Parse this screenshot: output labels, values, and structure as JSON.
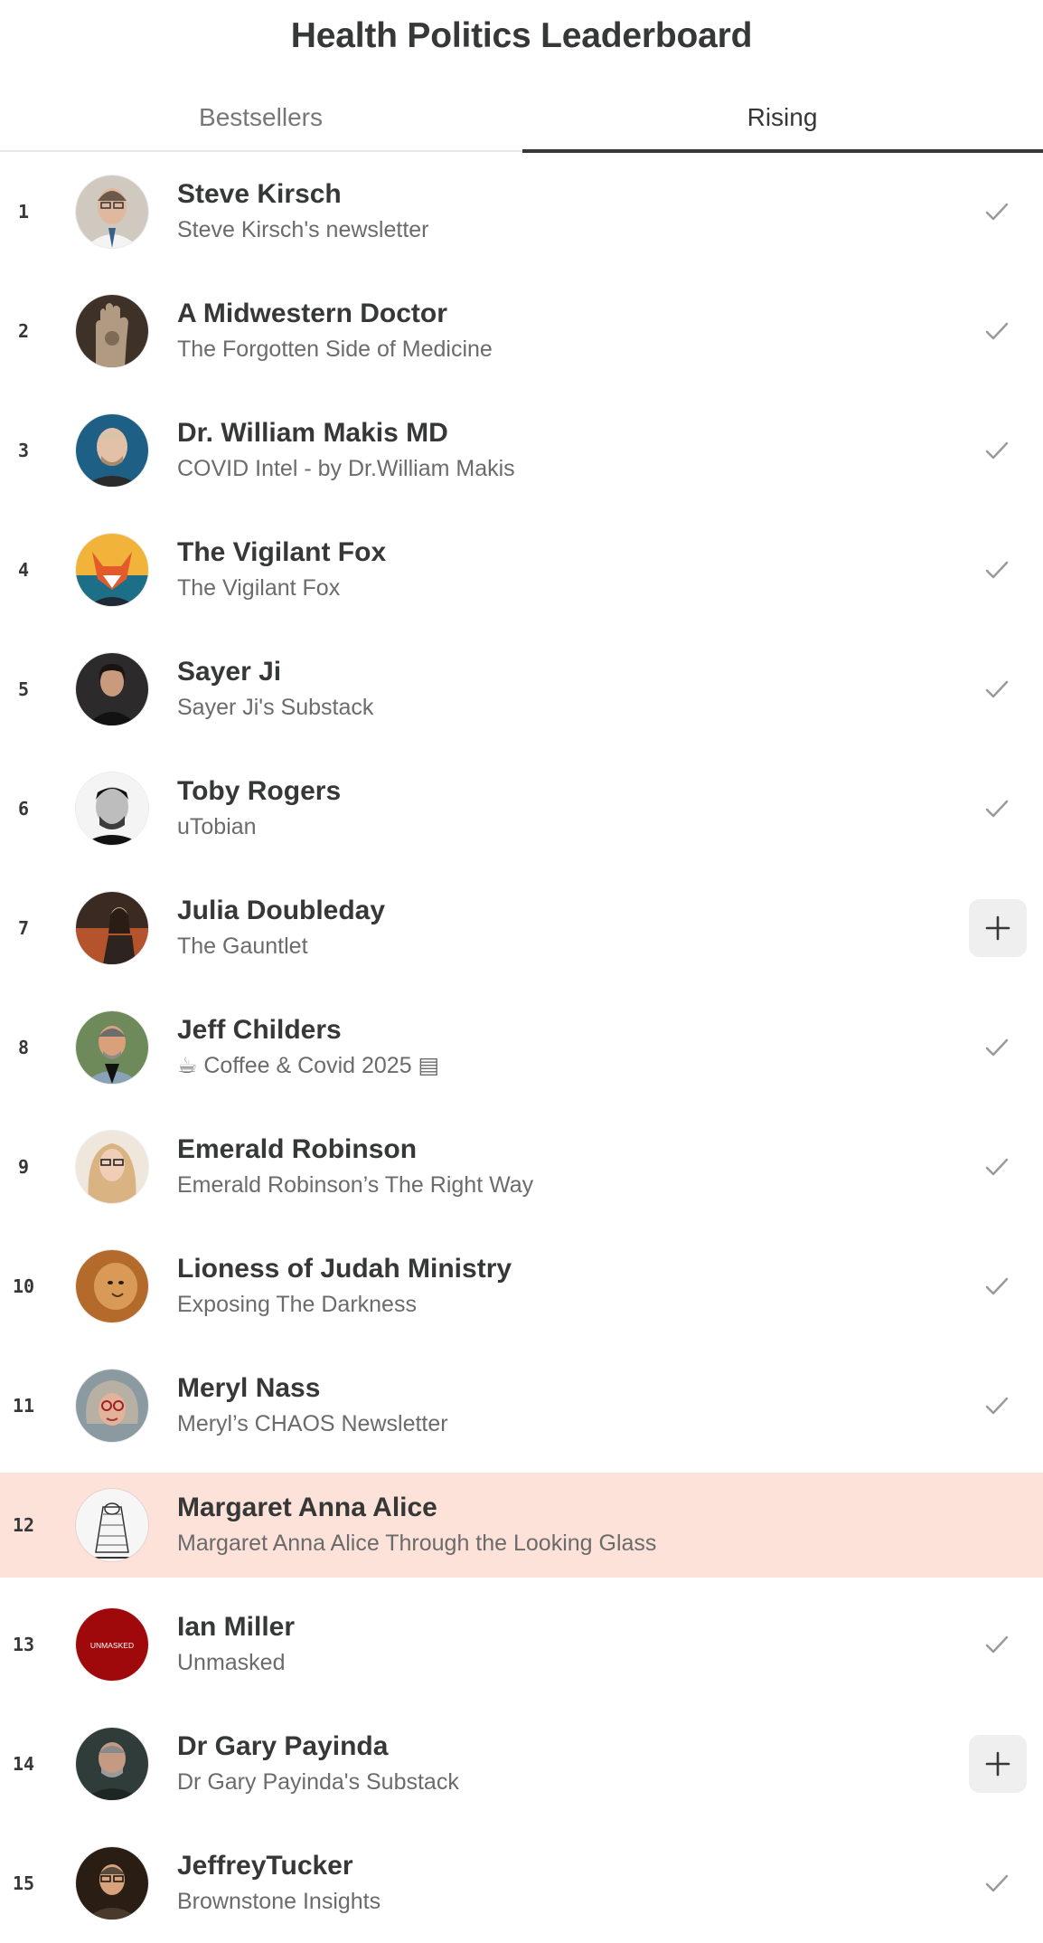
{
  "header": {
    "title": "Health Politics Leaderboard"
  },
  "tabs": [
    {
      "label": "Bestsellers",
      "active": false
    },
    {
      "label": "Rising",
      "active": true
    }
  ],
  "colors": {
    "text": "#363737",
    "muted": "#6b6b6b",
    "highlight": "#fde2da",
    "active_underline": "#363737"
  },
  "leaderboard": [
    {
      "rank": "1",
      "name": "Steve Kirsch",
      "publication": "Steve Kirsch's newsletter",
      "action": "check-icon"
    },
    {
      "rank": "2",
      "name": "A Midwestern Doctor",
      "publication": "The Forgotten Side of Medicine",
      "action": "check-icon"
    },
    {
      "rank": "3",
      "name": "Dr. William Makis MD",
      "publication": "COVID Intel - by Dr.William Makis",
      "action": "check-icon"
    },
    {
      "rank": "4",
      "name": "The Vigilant Fox",
      "publication": "The Vigilant Fox",
      "action": "check-icon"
    },
    {
      "rank": "5",
      "name": "Sayer Ji",
      "publication": "Sayer Ji's Substack",
      "action": "check-icon"
    },
    {
      "rank": "6",
      "name": "Toby Rogers",
      "publication": "uTobian",
      "action": "check-icon"
    },
    {
      "rank": "7",
      "name": "Julia Doubleday",
      "publication": "The Gauntlet",
      "action": "plus-icon"
    },
    {
      "rank": "8",
      "name": "Jeff Childers",
      "publication": "☕ Coffee & Covid 2025 ▤",
      "action": "check-icon"
    },
    {
      "rank": "9",
      "name": "Emerald Robinson",
      "publication": "Emerald Robinson’s The Right Way",
      "action": "check-icon"
    },
    {
      "rank": "10",
      "name": "Lioness of Judah Ministry",
      "publication": "Exposing The Darkness",
      "action": "check-icon"
    },
    {
      "rank": "11",
      "name": "Meryl Nass",
      "publication": "Meryl’s CHAOS Newsletter",
      "action": "check-icon"
    },
    {
      "rank": "12",
      "name": "Margaret Anna Alice",
      "publication": "Margaret Anna Alice Through the Looking Glass",
      "action": "none",
      "highlighted": true
    },
    {
      "rank": "13",
      "name": "Ian Miller",
      "publication": "Unmasked",
      "action": "check-icon",
      "avatar_text": "UNMASKED"
    },
    {
      "rank": "14",
      "name": "Dr Gary Payinda",
      "publication": "Dr Gary Payinda's Substack",
      "action": "plus-icon"
    },
    {
      "rank": "15",
      "name": "JeffreyTucker",
      "publication": "Brownstone Insights",
      "action": "check-icon"
    }
  ]
}
